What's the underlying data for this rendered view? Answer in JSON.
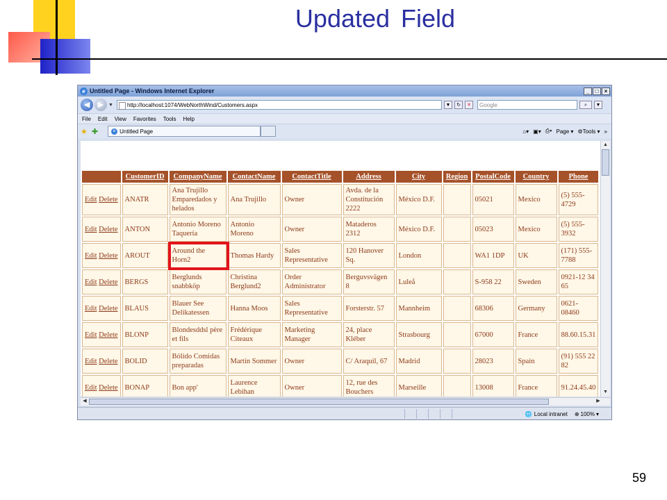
{
  "slide": {
    "title": "Updated  Field",
    "page_number": "59"
  },
  "browser": {
    "window_title": "Untitled Page - Windows Internet Explorer",
    "url": "http://localhost:1074/WebNorthWind/Customers.aspx",
    "search_placeholder": "Google",
    "menu": [
      "File",
      "Edit",
      "View",
      "Favorites",
      "Tools",
      "Help"
    ],
    "tab_title": "Untitled Page",
    "toolbar_page": "Page",
    "toolbar_tools": "Tools",
    "status_zone": "Local intranet",
    "zoom": "100%"
  },
  "grid": {
    "headers": [
      "",
      "CustomerID",
      "CompanyName",
      "ContactName",
      "ContactTitle",
      "Address",
      "City",
      "Region",
      "PostalCode",
      "Country",
      "Phone"
    ],
    "edit_label": "Edit",
    "delete_label": "Delete",
    "rows": [
      {
        "id": "ANATR",
        "company": "Ana Trujillo Emparedados y helados",
        "contact": "Ana Trujillo",
        "title": "Owner",
        "address": "Avda. de la Constitución 2222",
        "city": "México D.F.",
        "region": "",
        "postal": "05021",
        "country": "Mexico",
        "phone": "(5) 555-4729"
      },
      {
        "id": "ANTON",
        "company": "Antonio Moreno Taquería",
        "contact": "Antonio Moreno",
        "title": "Owner",
        "address": "Mataderos 2312",
        "city": "México D.F.",
        "region": "",
        "postal": "05023",
        "country": "Mexico",
        "phone": "(5) 555-3932"
      },
      {
        "id": "AROUT",
        "company": "Around the Horn2",
        "contact": "Thomas Hardy",
        "title": "Sales Representative",
        "address": "120 Hanover Sq.",
        "city": "London",
        "region": "",
        "postal": "WA1 1DP",
        "country": "UK",
        "phone": "(171) 555-7788"
      },
      {
        "id": "BERGS",
        "company": "Berglunds snabbköp",
        "contact": "Christina Berglund2",
        "title": "Order Administrator",
        "address": "Berguvsvägen 8",
        "city": "Luleå",
        "region": "",
        "postal": "S-958 22",
        "country": "Sweden",
        "phone": "0921-12 34 65"
      },
      {
        "id": "BLAUS",
        "company": "Blauer See Delikatessen",
        "contact": "Hanna Moos",
        "title": "Sales Representative",
        "address": "Forsterstr. 57",
        "city": "Mannheim",
        "region": "",
        "postal": "68306",
        "country": "Germany",
        "phone": "0621-08460"
      },
      {
        "id": "BLONP",
        "company": "Blondesddsl père et fils",
        "contact": "Frédérique Citeaux",
        "title": "Marketing Manager",
        "address": "24, place Kléber",
        "city": "Strasbourg",
        "region": "",
        "postal": "67000",
        "country": "France",
        "phone": "88.60.15.31"
      },
      {
        "id": "BOLID",
        "company": "Bólido Comidas preparadas",
        "contact": "Martín Sommer",
        "title": "Owner",
        "address": "C/ Araquil, 67",
        "city": "Madrid",
        "region": "",
        "postal": "28023",
        "country": "Spain",
        "phone": "(91) 555 22 82"
      },
      {
        "id": "BONAP",
        "company": "Bon app'",
        "contact": "Laurence Lebihan",
        "title": "Owner",
        "address": "12, rue des Bouchers",
        "city": "Marseille",
        "region": "",
        "postal": "13008",
        "country": "France",
        "phone": "91.24.45.40"
      }
    ]
  }
}
